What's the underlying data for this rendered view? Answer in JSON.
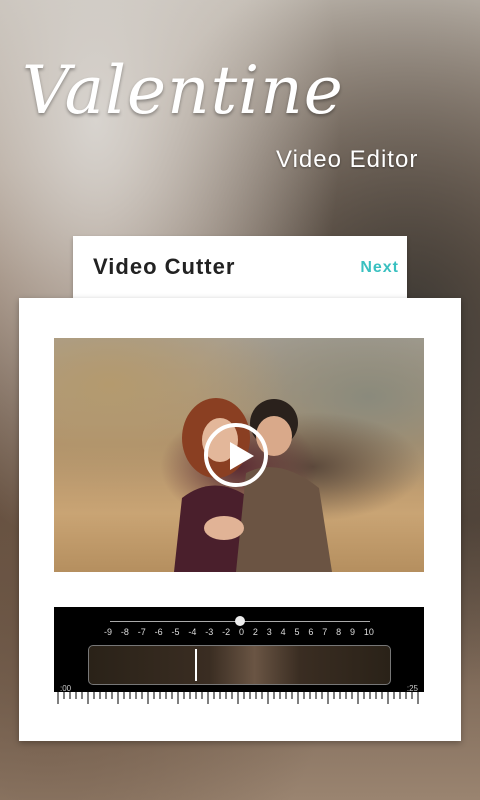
{
  "branding": {
    "title": "Valentine",
    "subtitle": "Video Editor"
  },
  "header": {
    "title": "Video Cutter",
    "next_label": "Next"
  },
  "timeline": {
    "scale_labels": [
      "-9",
      "-8",
      "-7",
      "-6",
      "-5",
      "-4",
      "-3",
      "-2",
      "0",
      "2",
      "3",
      "4",
      "5",
      "6",
      "7",
      "8",
      "9",
      "10"
    ],
    "start_time": ":00",
    "end_time": ":25"
  },
  "colors": {
    "accent": "#39c0c0",
    "card": "#ffffff",
    "timeline_bg": "#000000"
  },
  "icons": {
    "play": "play-icon"
  }
}
